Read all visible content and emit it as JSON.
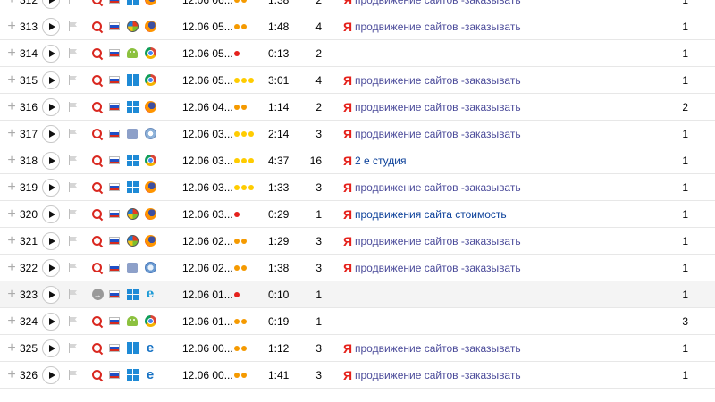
{
  "colors": {
    "dot_orange": "#f59a00",
    "dot_yellow": "#ffcc00",
    "dot_red": "#e5211b",
    "yandex_red": "#e5211b"
  },
  "rows": [
    {
      "num": "312",
      "source": "search-icon",
      "os": "windows",
      "browser": "firefox",
      "date": "12.06 06...",
      "dots": [
        "orange",
        "orange"
      ],
      "duration": "1:38",
      "pages": "2",
      "yandex": true,
      "query": "продвижение сайтов -заказывать",
      "query_link": false,
      "last": "1"
    },
    {
      "num": "313",
      "source": "search-icon",
      "os": "windows-xp",
      "browser": "firefox",
      "date": "12.06 05...",
      "dots": [
        "orange",
        "orange"
      ],
      "duration": "1:48",
      "pages": "4",
      "yandex": true,
      "query": "продвижение сайтов -заказывать",
      "query_link": false,
      "last": "1"
    },
    {
      "num": "314",
      "source": "search-icon",
      "os": "android",
      "browser": "chrome",
      "date": "12.06 05...",
      "dots": [
        "red"
      ],
      "duration": "0:13",
      "pages": "2",
      "yandex": false,
      "query": "",
      "query_link": false,
      "last": "1"
    },
    {
      "num": "315",
      "source": "search-icon",
      "os": "windows",
      "browser": "chrome",
      "date": "12.06 05...",
      "dots": [
        "yellow",
        "yellow",
        "yellow"
      ],
      "duration": "3:01",
      "pages": "4",
      "yandex": true,
      "query": "продвижение сайтов -заказывать",
      "query_link": false,
      "last": "1"
    },
    {
      "num": "316",
      "source": "search-icon",
      "os": "windows",
      "browser": "firefox",
      "date": "12.06 04...",
      "dots": [
        "orange",
        "orange"
      ],
      "duration": "1:14",
      "pages": "2",
      "yandex": true,
      "query": "продвижение сайтов -заказывать",
      "query_link": false,
      "last": "2"
    },
    {
      "num": "317",
      "source": "search-icon",
      "os": "mac",
      "browser": "opera",
      "date": "12.06 03...",
      "dots": [
        "yellow",
        "yellow",
        "yellow"
      ],
      "duration": "2:14",
      "pages": "3",
      "yandex": true,
      "query": "продвижение сайтов -заказывать",
      "query_link": false,
      "last": "1"
    },
    {
      "num": "318",
      "source": "search-icon",
      "os": "windows",
      "browser": "chrome",
      "date": "12.06 03...",
      "dots": [
        "yellow",
        "yellow",
        "yellow"
      ],
      "duration": "4:37",
      "pages": "16",
      "yandex": true,
      "query": "2 е студия",
      "query_link": true,
      "last": "1"
    },
    {
      "num": "319",
      "source": "search-icon",
      "os": "windows",
      "browser": "firefox",
      "date": "12.06 03...",
      "dots": [
        "yellow",
        "yellow",
        "yellow"
      ],
      "duration": "1:33",
      "pages": "3",
      "yandex": true,
      "query": "продвижение сайтов -заказывать",
      "query_link": false,
      "last": "1"
    },
    {
      "num": "320",
      "source": "search-icon",
      "os": "windows-xp",
      "browser": "firefox",
      "date": "12.06 03...",
      "dots": [
        "red"
      ],
      "duration": "0:29",
      "pages": "1",
      "yandex": true,
      "query": "продвижения сайта стоимость",
      "query_link": true,
      "last": "1"
    },
    {
      "num": "321",
      "source": "search-icon",
      "os": "windows-xp",
      "browser": "firefox",
      "date": "12.06 02...",
      "dots": [
        "orange",
        "orange"
      ],
      "duration": "1:29",
      "pages": "3",
      "yandex": true,
      "query": "продвижение сайтов -заказывать",
      "query_link": false,
      "last": "1"
    },
    {
      "num": "322",
      "source": "search-icon",
      "os": "mac",
      "browser": "safari",
      "date": "12.06 02...",
      "dots": [
        "orange",
        "orange"
      ],
      "duration": "1:38",
      "pages": "3",
      "yandex": true,
      "query": "продвижение сайтов -заказывать",
      "query_link": false,
      "last": "1"
    },
    {
      "num": "323",
      "source": "direct-icon",
      "os": "windows",
      "browser": "ie",
      "date": "12.06 01...",
      "dots": [
        "red"
      ],
      "duration": "0:10",
      "pages": "1",
      "yandex": false,
      "query": "",
      "query_link": false,
      "last": "1",
      "highlight": true
    },
    {
      "num": "324",
      "source": "search-icon",
      "os": "android",
      "browser": "chrome",
      "date": "12.06 01...",
      "dots": [
        "orange",
        "orange"
      ],
      "duration": "0:19",
      "pages": "1",
      "yandex": false,
      "query": "",
      "query_link": false,
      "last": "3"
    },
    {
      "num": "325",
      "source": "search-icon",
      "os": "windows",
      "browser": "edge",
      "date": "12.06 00...",
      "dots": [
        "orange",
        "orange"
      ],
      "duration": "1:12",
      "pages": "3",
      "yandex": true,
      "query": "продвижение сайтов -заказывать",
      "query_link": false,
      "last": "1"
    },
    {
      "num": "326",
      "source": "search-icon",
      "os": "windows",
      "browser": "edge",
      "date": "12.06 00...",
      "dots": [
        "orange",
        "orange"
      ],
      "duration": "1:41",
      "pages": "3",
      "yandex": true,
      "query": "продвижение сайтов -заказывать",
      "query_link": false,
      "last": "1"
    }
  ],
  "labels": {
    "expand_glyph": "+",
    "yandex_glyph": "Я"
  }
}
